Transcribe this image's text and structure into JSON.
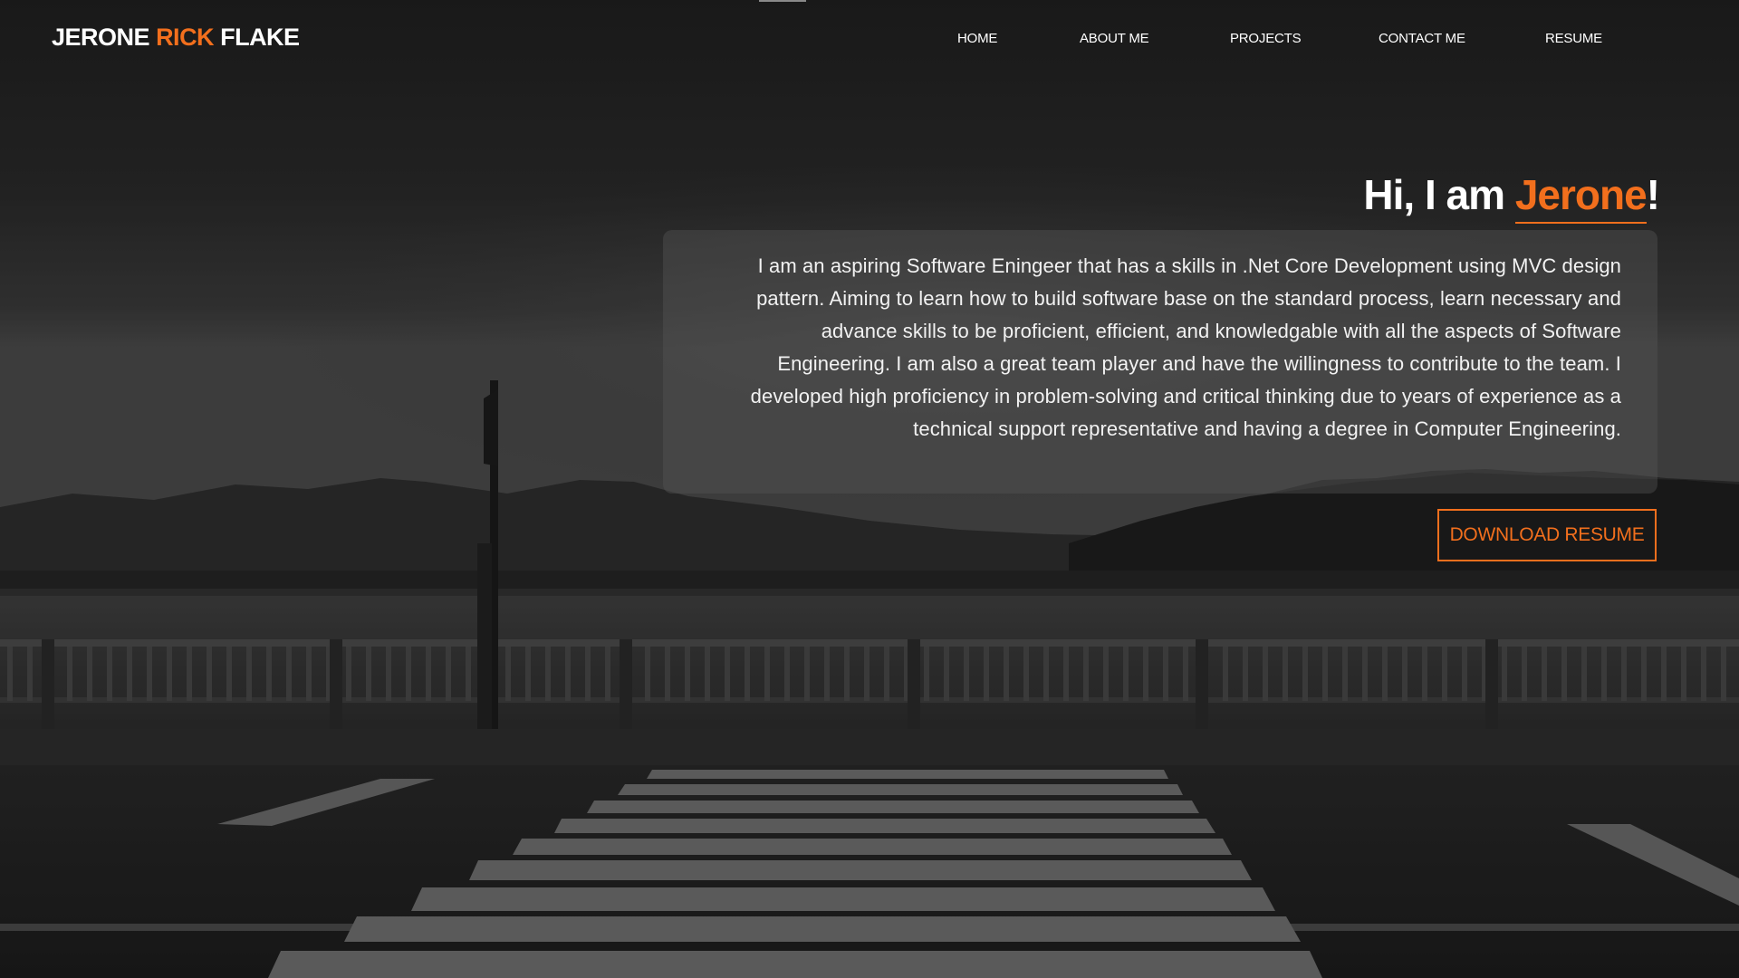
{
  "brand": {
    "first": "JERONE",
    "middle": "RICK",
    "last": "FLAKE"
  },
  "nav": {
    "items": [
      {
        "label": "HOME"
      },
      {
        "label": "ABOUT ME"
      },
      {
        "label": "PROJECTS"
      },
      {
        "label": "CONTACT ME"
      },
      {
        "label": "RESUME"
      }
    ]
  },
  "hero": {
    "greeting_prefix": "Hi, I am",
    "name": "Jerone",
    "greeting_suffix": "!",
    "about": "I am an aspiring Software Eningeer that has a skills in .Net Core Development using MVC design pattern. Aiming to learn how to build software base on the standard process, learn necessary and advance skills to be proficient, efficient, and knowledgable with all the aspects of Software Engineering. I am also a great team player and have the willingness to contribute to the team. I developed high proficiency in problem-solving and critical thinking due to years of experience as a technical support representative and having a degree in Computer Engineering.",
    "download_label": "DOWNLOAD RESUME"
  },
  "colors": {
    "accent": "#f26f1d",
    "text": "#ffffff",
    "card_background": "rgba(85,85,85,0.42)"
  },
  "icons": {
    "background": "grayscale-waterfront-crosswalk-photo"
  }
}
